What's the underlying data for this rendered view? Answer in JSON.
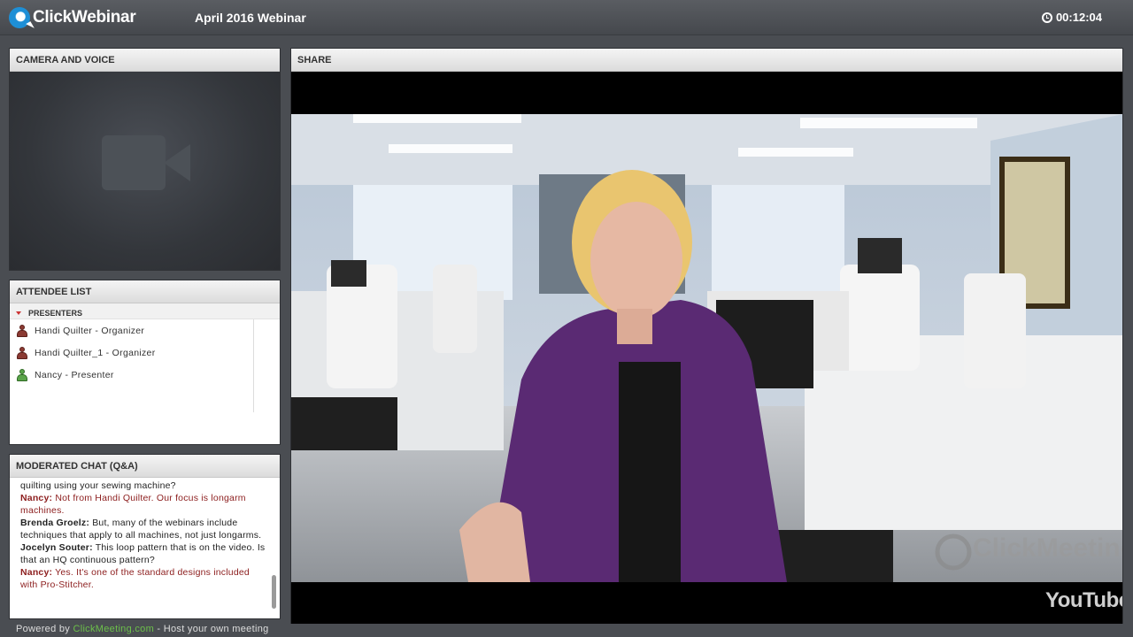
{
  "header": {
    "logo_text": "ClickWebinar",
    "webinar_title": "April 2016 Webinar",
    "timer": "00:12:04",
    "brand_color": "#1e8fd6"
  },
  "camera": {
    "title": "CAMERA AND VOICE",
    "icon": "video-camera-icon"
  },
  "attendees": {
    "title": "ATTENDEE LIST",
    "group_label": "PRESENTERS",
    "rows": [
      {
        "name": "Handi Quilter - Organizer",
        "role": "organizer"
      },
      {
        "name": "Handi Quilter_1 - Organizer",
        "role": "organizer"
      },
      {
        "name": "Nancy - Presenter",
        "role": "presenter"
      }
    ]
  },
  "chat": {
    "title": "MODERATED CHAT (Q&A)",
    "messages": [
      {
        "author": "",
        "text": "quilting using your sewing machine?",
        "highlight": false
      },
      {
        "author": "Nancy:",
        "text": " Not from Handi Quilter. Our focus is longarm machines.",
        "highlight": true
      },
      {
        "author": "Brenda Groelz:",
        "text": " But, many of the webinars include techniques that apply to all machines, not just longarms.",
        "highlight": false
      },
      {
        "author": "Jocelyn Souter:",
        "text": " This loop pattern that is on the video.  Is that an HQ continuous pattern?",
        "highlight": false
      },
      {
        "author": "Nancy:",
        "text": " Yes. It's one of the standard designs included with Pro-Stitcher.",
        "highlight": true
      }
    ]
  },
  "share": {
    "title": "SHARE",
    "watermark": "ClickMeeting",
    "youtube_label": "YouTube"
  },
  "footer": {
    "prefix": "Powered by ",
    "link": "ClickMeeting.com",
    "suffix": " - Host your own meeting"
  }
}
